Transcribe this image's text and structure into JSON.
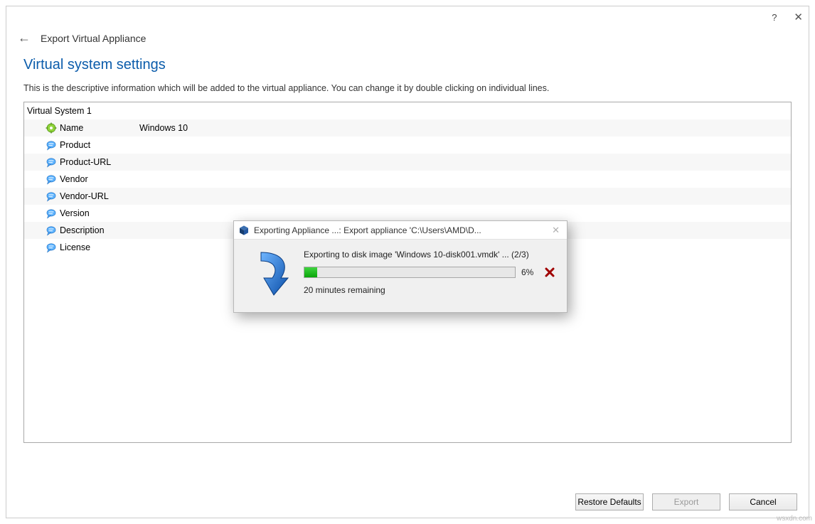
{
  "titlebar": {
    "help": "?",
    "close": "✕"
  },
  "header": {
    "back": "←",
    "title": "Export Virtual Appliance"
  },
  "section": {
    "title": "Virtual system settings",
    "desc": "This is the descriptive information which will be added to the virtual appliance. You can change it by double clicking on individual lines."
  },
  "system_label": "Virtual System 1",
  "rows": [
    {
      "key": "Name",
      "val": "Windows 10",
      "icon": "gear"
    },
    {
      "key": "Product",
      "val": "",
      "icon": "bubble"
    },
    {
      "key": "Product-URL",
      "val": "",
      "icon": "bubble"
    },
    {
      "key": "Vendor",
      "val": "",
      "icon": "bubble"
    },
    {
      "key": "Vendor-URL",
      "val": "",
      "icon": "bubble"
    },
    {
      "key": "Version",
      "val": "",
      "icon": "bubble"
    },
    {
      "key": "Description",
      "val": "",
      "icon": "bubble"
    },
    {
      "key": "License",
      "val": "",
      "icon": "bubble"
    }
  ],
  "footer": {
    "restore": "Restore Defaults",
    "export": "Export",
    "cancel": "Cancel"
  },
  "dialog": {
    "title": "Exporting Appliance ...: Export appliance 'C:\\Users\\AMD\\D...",
    "msg": "Exporting to disk image 'Windows 10-disk001.vmdk' ... (2/3)",
    "pct": "6%",
    "remain": "20 minutes remaining"
  },
  "watermark": "wsxdn.com"
}
